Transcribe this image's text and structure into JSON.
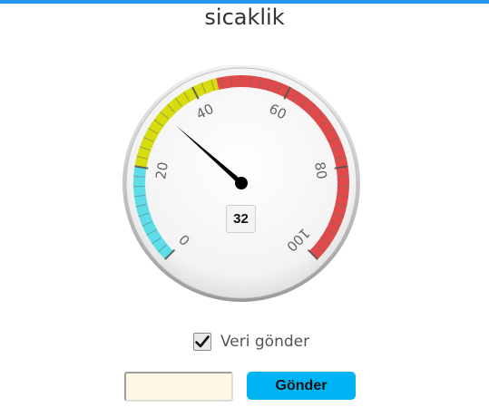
{
  "header": {
    "title": "sicaklik"
  },
  "gauge": {
    "min": 0,
    "max": 100,
    "value": 32,
    "value_text": "32",
    "tick_labels": [
      "0",
      "20",
      "40",
      "60",
      "80",
      "100"
    ],
    "bands": [
      {
        "from": 0,
        "to": 20,
        "color": "#5cdde8"
      },
      {
        "from": 20,
        "to": 45,
        "color": "#d6dc0e"
      },
      {
        "from": 45,
        "to": 100,
        "color": "#e04a4a"
      }
    ],
    "needle_icon": "needle-icon"
  },
  "form": {
    "checkbox_label": "Veri gönder",
    "checkbox_checked": true,
    "input_value": "",
    "send_label": "Gönder"
  },
  "colors": {
    "accent_bar": "#2196f3",
    "button": "#00b4f4",
    "input_bg": "#fdf8e5"
  }
}
